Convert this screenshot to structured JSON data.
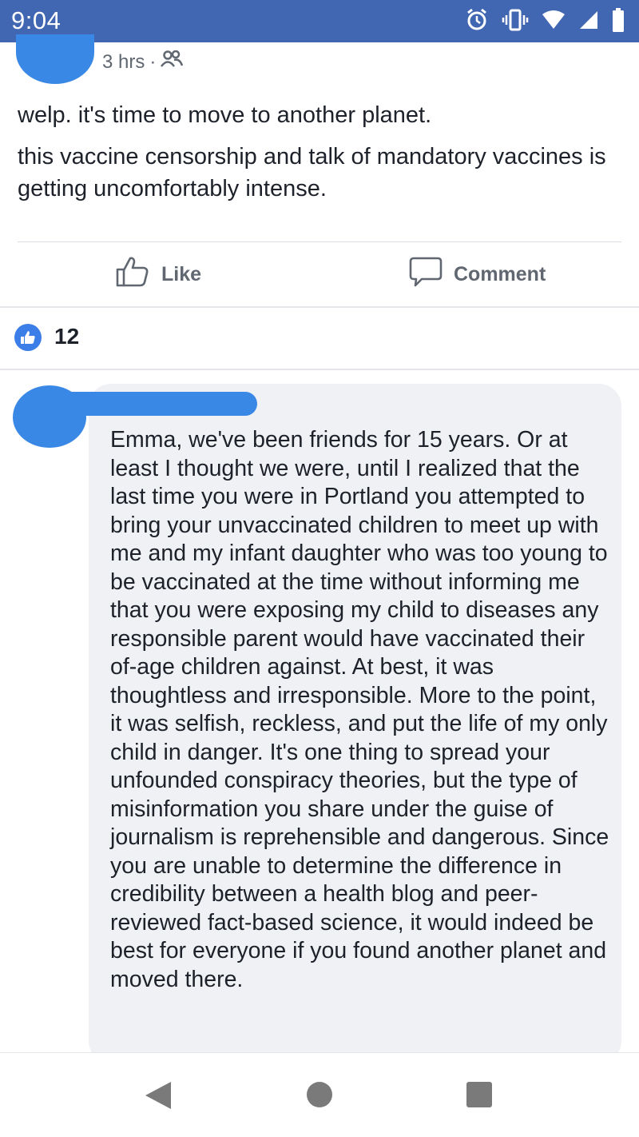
{
  "status_bar": {
    "time": "9:04",
    "icons": [
      "alarm-icon",
      "vibrate-icon",
      "wifi-icon",
      "signal-icon",
      "battery-icon"
    ]
  },
  "post": {
    "timestamp": "3 hrs",
    "separator": "·",
    "audience_icon": "friends-icon",
    "paragraphs": [
      "welp. it's time to move to another planet.",
      "this vaccine censorship and talk of mandatory vaccines is getting uncomfortably intense."
    ]
  },
  "actions": {
    "like_label": "Like",
    "comment_label": "Comment"
  },
  "reactions": {
    "count": "12"
  },
  "comment": {
    "text": "Emma, we've been friends for 15 years. Or at least I thought we were, until I realized that the last time you were in Portland you attempted to bring your unvaccinated children to meet up with me and my infant daughter who was too young to be vaccinated at the time without informing me that you were exposing my child to diseases any responsible parent would have vaccinated their of-age children against. At best, it was thoughtless and irresponsible. More to the point, it was selfish, reckless, and put the life of my only child in danger. It's one thing to spread your unfounded conspiracy theories, but the type of misinformation you share under the guise of journalism is reprehensible and dangerous. Since you are unable to determine the difference in credibility between a health blog and peer-reviewed fact-based science, it would indeed be best for everyone if you found another planet and moved there."
  },
  "colors": {
    "status_bar": "#4267b2",
    "redaction": "#3a88e6",
    "like_badge": "#3b7ee8",
    "comment_bubble": "#f0f1f5"
  }
}
